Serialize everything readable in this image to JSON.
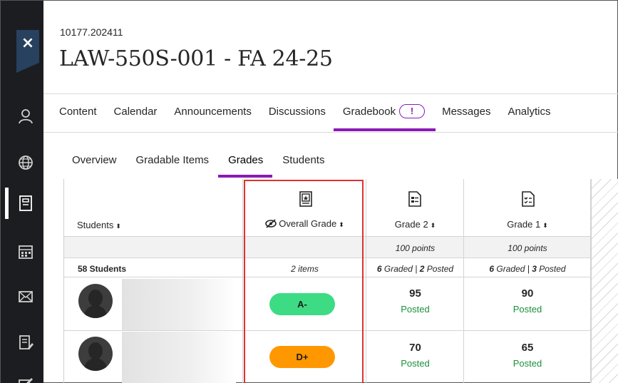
{
  "course": {
    "id": "10177.202411",
    "title": "LAW-550S-001 - FA 24-25"
  },
  "rail": {
    "close_symbol": "×",
    "items": [
      "user-icon",
      "globe-icon",
      "courses-icon",
      "calendar-icon",
      "mail-icon",
      "grades-icon",
      "edit-icon"
    ]
  },
  "tabs": [
    {
      "label": "Content"
    },
    {
      "label": "Calendar"
    },
    {
      "label": "Announcements"
    },
    {
      "label": "Discussions"
    },
    {
      "label": "Gradebook",
      "badge": "!"
    },
    {
      "label": "Messages"
    },
    {
      "label": "Analytics"
    }
  ],
  "subtabs": [
    {
      "label": "Overview"
    },
    {
      "label": "Gradable Items"
    },
    {
      "label": "Grades"
    },
    {
      "label": "Students"
    }
  ],
  "grid": {
    "columns": [
      {
        "title": "Students",
        "sort": "⬍"
      },
      {
        "title": "Overall Grade",
        "sort": "⬍",
        "icon": "overall-grade-icon",
        "hidden_icon": "eye-slash-icon"
      },
      {
        "title": "Grade 2",
        "sort": "⬍",
        "icon": "assignment-icon",
        "points": "100 points",
        "summary_bold_a": "6",
        "summary_a": " Graded | ",
        "summary_bold_b": "2",
        "summary_b": " Posted"
      },
      {
        "title": "Grade 1",
        "sort": "⬍",
        "icon": "quiz-icon",
        "points": "100 points",
        "summary_bold_a": "6",
        "summary_a": " Graded | ",
        "summary_bold_b": "3",
        "summary_b": " Posted"
      }
    ],
    "student_count": "58 Students",
    "overall_items": "2 items",
    "rows": [
      {
        "overall": "A-",
        "overall_color": "#3ddc84",
        "grade2": "95",
        "grade2_status": "Posted",
        "grade1": "90",
        "grade1_status": "Posted"
      },
      {
        "overall": "D+",
        "overall_color": "#ff9800",
        "grade2": "70",
        "grade2_status": "Posted",
        "grade1": "65",
        "grade1_status": "Posted"
      }
    ]
  },
  "colors": {
    "accent": "#8a1ab8",
    "posted": "#1a8f3c",
    "highlight": "#e0322e"
  }
}
